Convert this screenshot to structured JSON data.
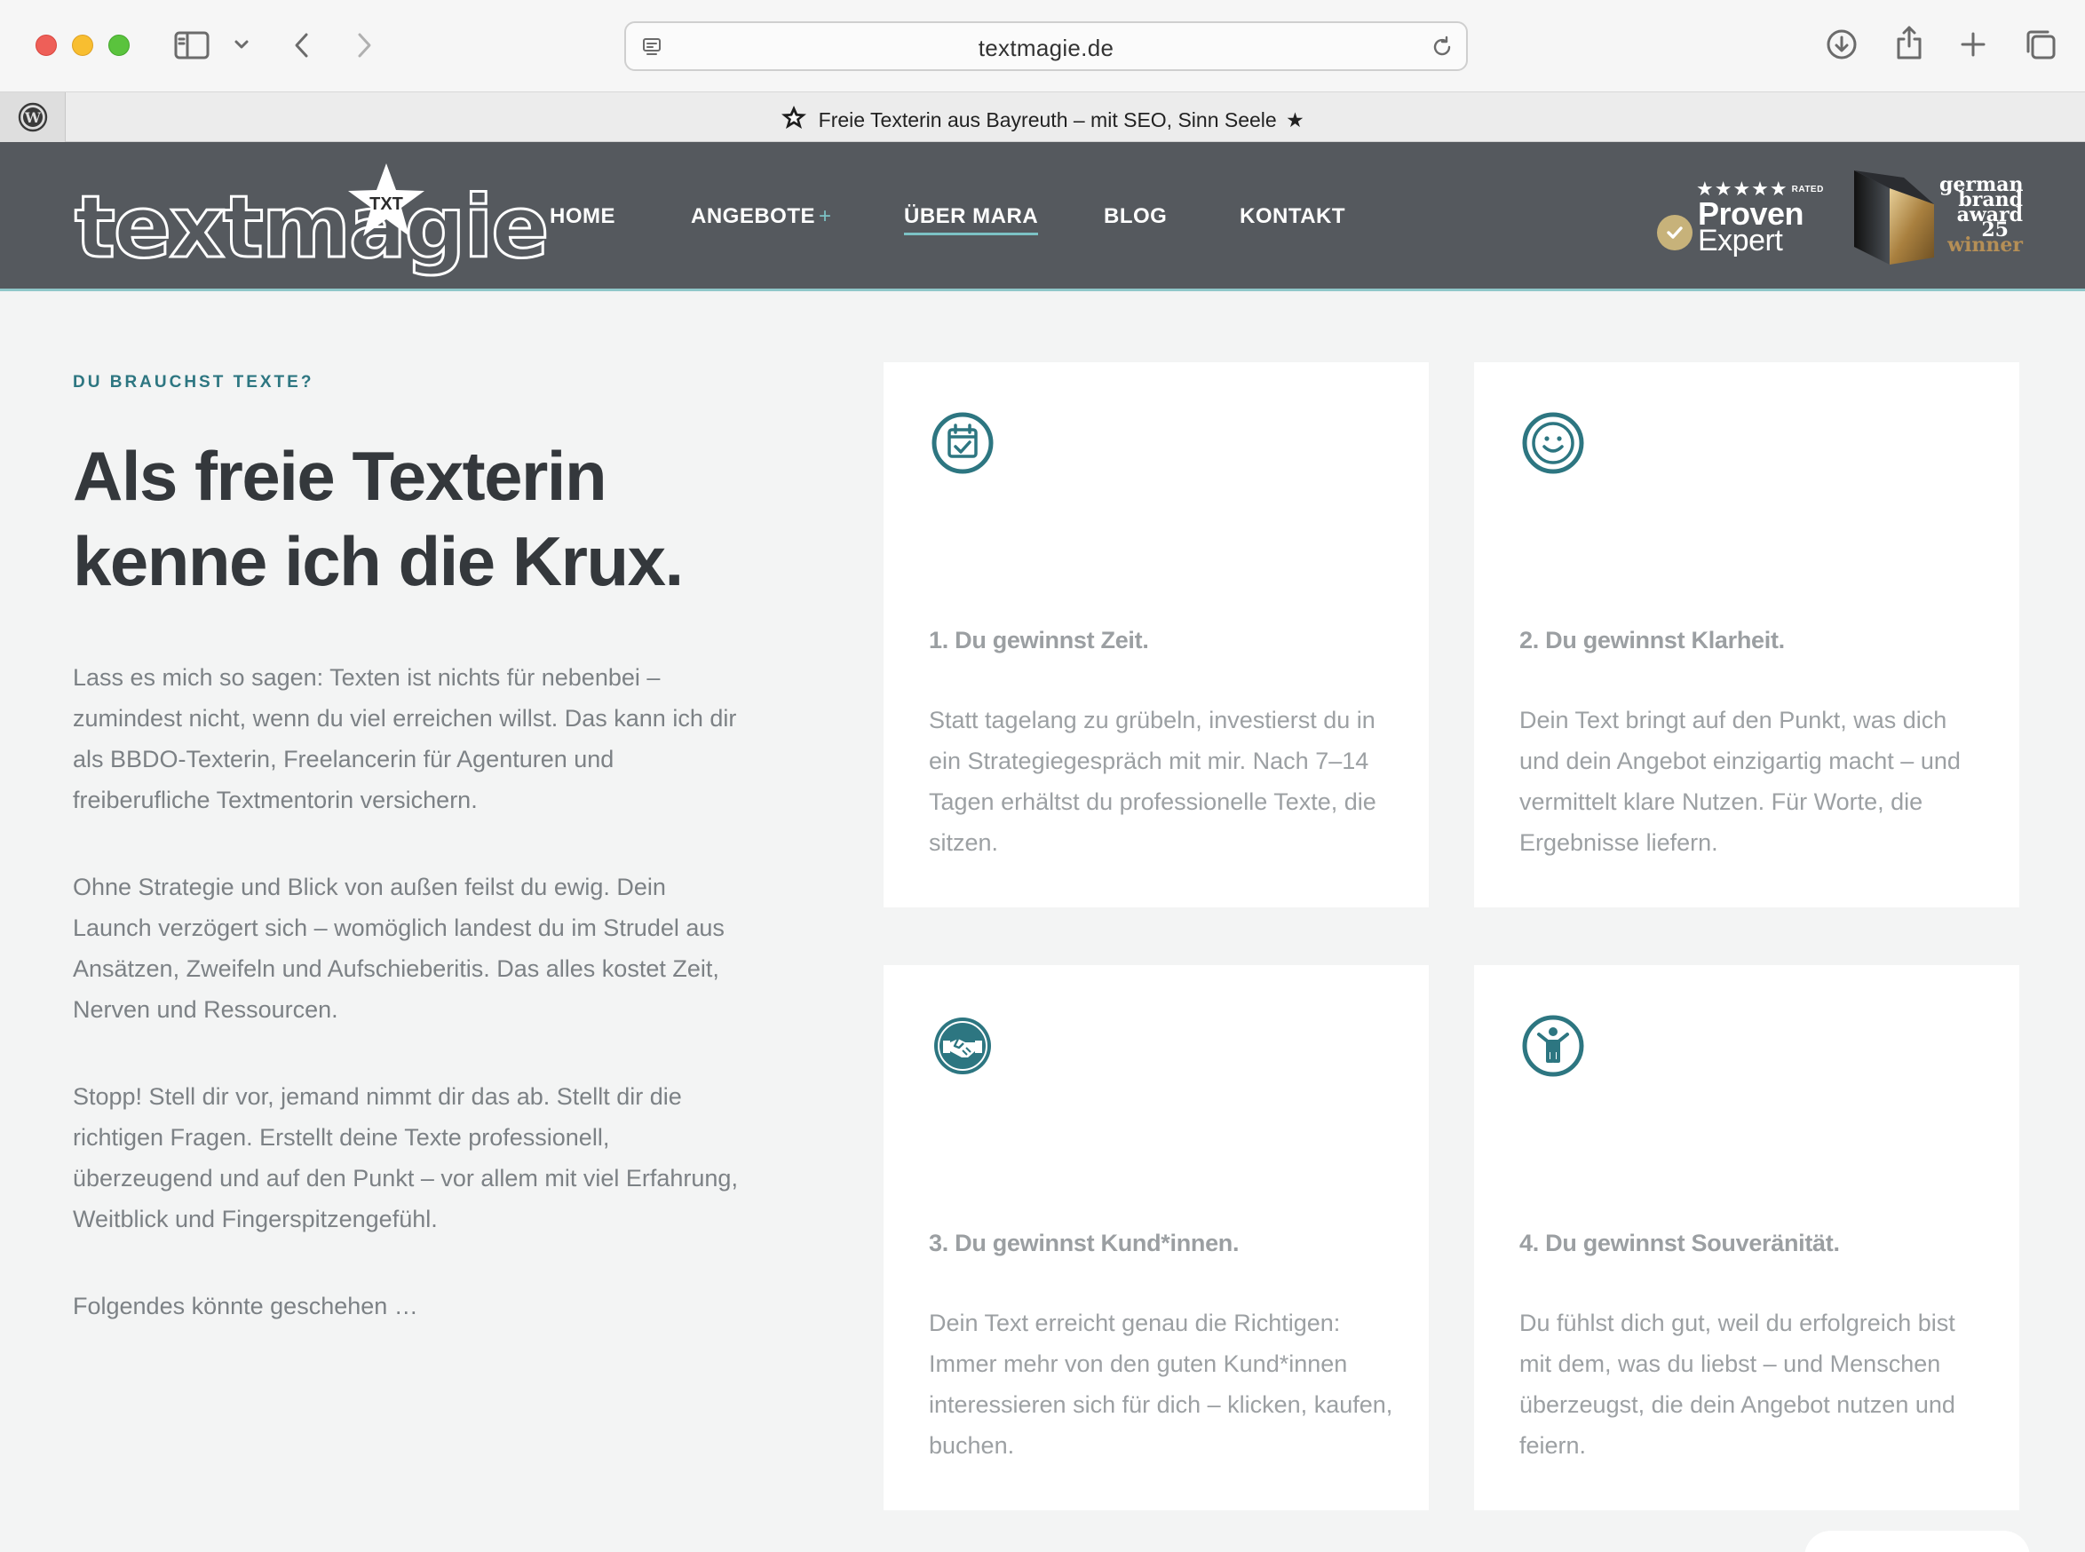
{
  "browser": {
    "url": "textmagie.de",
    "tab_title": "Freie Texterin aus Bayreuth – mit SEO, Sinn Seele"
  },
  "header": {
    "logo_text": "textmagie",
    "logo_badge": "TXT",
    "nav": [
      {
        "label": "HOME"
      },
      {
        "label": "ANGEBOTE",
        "suffix": "+"
      },
      {
        "label": "ÜBER MARA"
      },
      {
        "label": "BLOG"
      },
      {
        "label": "KONTAKT"
      }
    ],
    "proven_expert": {
      "stars": "★★★★★",
      "rated": "RATED",
      "line1": "Proven",
      "line2": "Expert"
    },
    "german_brand_award": {
      "line1": "german",
      "line2": "brand",
      "line3": "award",
      "year": "25",
      "line4": "winner"
    }
  },
  "intro": {
    "eyebrow": "DU BRAUCHST TEXTE?",
    "headline_line1": "Als freie Texterin",
    "headline_line2": "kenne ich die Krux.",
    "paragraphs": [
      "Lass es mich so sagen: Texten ist nichts für nebenbei – zumindest nicht, wenn du viel erreichen willst. Das kann ich dir als BBDO-Texterin, Freelancerin für Agenturen und freiberufliche Textmentorin versichern.",
      "Ohne Strategie und Blick von außen feilst du ewig. Dein Launch verzögert sich – womöglich landest du im Strudel aus Ansätzen, Zweifeln und Aufschieberitis. Das alles kostet Zeit, Nerven und Ressourcen.",
      "Stopp! Stell dir vor, jemand nimmt dir das ab. Stellt dir die richtigen Fragen. Erstellt deine Texte professionell, überzeugend und auf den Punkt – vor allem mit viel Erfahrung, Weitblick und Fingerspitzengefühl.",
      "Folgendes könnte geschehen …"
    ]
  },
  "cards": [
    {
      "icon": "calendar-check-icon",
      "title": "1. Du gewinnst Zeit.",
      "text": "Statt tagelang zu grübeln, investierst du in ein Strategiegespräch mit mir. Nach 7–14 Tagen erhältst du professionelle Texte, die sitzen."
    },
    {
      "icon": "smiley-icon",
      "title": "2. Du gewinnst Klarheit.",
      "text": "Dein Text bringt auf den Punkt, was dich und dein Angebot einzigartig macht – und vermittelt klare Nutzen. Für Worte, die Ergebnisse liefern."
    },
    {
      "icon": "handshake-icon",
      "title": "3. Du gewinnst Kund*innen.",
      "text": "Dein Text erreicht genau die Richtigen: Immer mehr von den guten Kund*innen interessieren sich für dich – klicken, kaufen, buchen."
    },
    {
      "icon": "person-cheering-icon",
      "title": "4. Du gewinnst Souveränität.",
      "text": "Du fühlst dich gut, weil du erfolgreich bist mit dem, was du liebst – und Menschen überzeugst, die dein Angebot nutzen und feiern."
    }
  ],
  "colors": {
    "accent": "#2d7681",
    "header_bg": "#55595e",
    "page_bg": "#f3f4f4",
    "card_bg": "#ffffff"
  }
}
